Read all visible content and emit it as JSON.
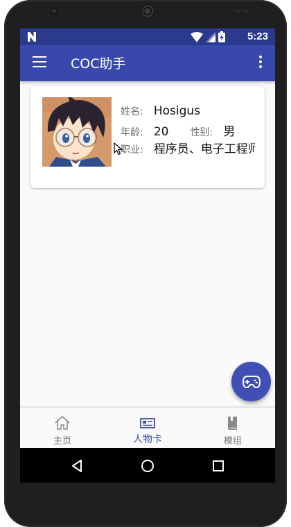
{
  "status_bar": {
    "time": "5:23"
  },
  "app_bar": {
    "title": "COC助手"
  },
  "character": {
    "name_label": "姓名:",
    "name": "Hosigus",
    "age_label": "年龄:",
    "age": "20",
    "gender_label": "性别:",
    "gender": "男",
    "job_label": "职业:",
    "job": "程序员、电子工程师"
  },
  "bottom_nav": {
    "items": [
      {
        "label": "主页",
        "icon": "home-icon",
        "active": false
      },
      {
        "label": "人物卡",
        "icon": "id-card-icon",
        "active": true
      },
      {
        "label": "模组",
        "icon": "book-icon",
        "active": false
      }
    ]
  },
  "fab": {
    "icon": "gamepad-icon"
  },
  "colors": {
    "primary": "#3949ab",
    "status_bar": "#2b3a8f",
    "fab": "#3f4fb5",
    "background": "#fafafa"
  }
}
